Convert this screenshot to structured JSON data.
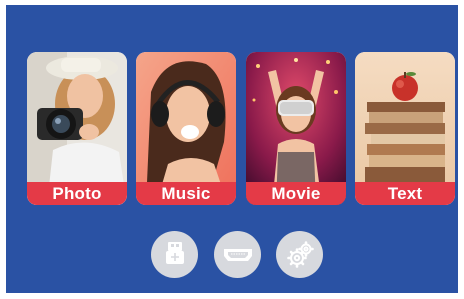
{
  "tiles": [
    {
      "id": "photo",
      "label": "Photo",
      "icon": "photo-camera-icon"
    },
    {
      "id": "music",
      "label": "Music",
      "icon": "headphones-icon"
    },
    {
      "id": "movie",
      "label": "Movie",
      "icon": "vr-headset-icon"
    },
    {
      "id": "text",
      "label": "Text",
      "icon": "books-icon"
    }
  ],
  "bottom_buttons": [
    {
      "id": "usb",
      "icon": "usb-icon"
    },
    {
      "id": "hdmi",
      "icon": "hdmi-icon"
    },
    {
      "id": "settings",
      "icon": "gear-icon"
    }
  ],
  "colors": {
    "background": "#2a52a4",
    "label_bar": "#e43a47",
    "button": "#d7d9de",
    "button_icon": "#ffffff"
  }
}
